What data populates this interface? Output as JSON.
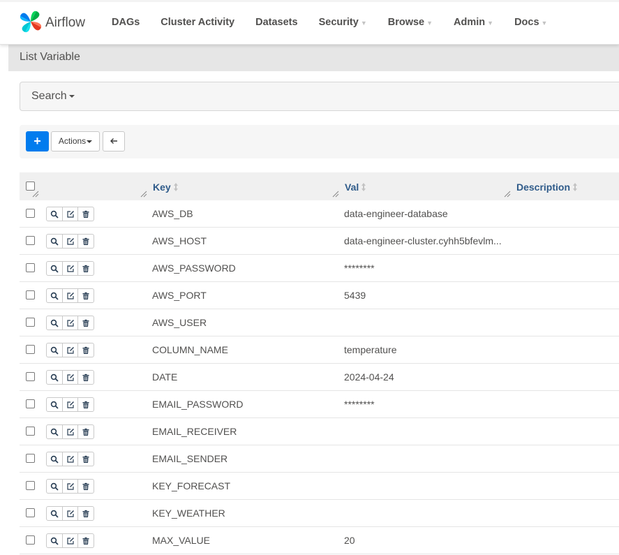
{
  "app": {
    "brand_name": "Airflow",
    "brand_colors": [
      "#017cee",
      "#00ad46",
      "#e43921",
      "#04d659",
      "#11e1ee",
      "#0cb6ff",
      "#ffd261",
      "#00c7d4"
    ]
  },
  "nav": {
    "items": [
      {
        "label": "DAGs",
        "dropdown": false
      },
      {
        "label": "Cluster Activity",
        "dropdown": false
      },
      {
        "label": "Datasets",
        "dropdown": false
      },
      {
        "label": "Security",
        "dropdown": true
      },
      {
        "label": "Browse",
        "dropdown": true
      },
      {
        "label": "Admin",
        "dropdown": true
      },
      {
        "label": "Docs",
        "dropdown": true
      }
    ]
  },
  "page": {
    "title": "List Variable",
    "search_label": "Search",
    "add_button_label": "+",
    "actions_label": "Actions",
    "back_icon": "arrow-left-icon"
  },
  "table": {
    "columns": [
      {
        "label": "Key",
        "sortable": true
      },
      {
        "label": "Val",
        "sortable": true
      },
      {
        "label": "Description",
        "sortable": true
      }
    ],
    "row_actions": [
      "search-icon",
      "edit-icon",
      "trash-icon"
    ],
    "rows": [
      {
        "key": "AWS_DB",
        "val": "data-engineer-database",
        "description": ""
      },
      {
        "key": "AWS_HOST",
        "val": "data-engineer-cluster.cyhh5bfevlm...",
        "description": ""
      },
      {
        "key": "AWS_PASSWORD",
        "val": "********",
        "description": ""
      },
      {
        "key": "AWS_PORT",
        "val": "5439",
        "description": ""
      },
      {
        "key": "AWS_USER",
        "val": "",
        "description": ""
      },
      {
        "key": "COLUMN_NAME",
        "val": "temperature",
        "description": ""
      },
      {
        "key": "DATE",
        "val": "2024-04-24",
        "description": ""
      },
      {
        "key": "EMAIL_PASSWORD",
        "val": "********",
        "description": ""
      },
      {
        "key": "EMAIL_RECEIVER",
        "val": "",
        "description": ""
      },
      {
        "key": "EMAIL_SENDER",
        "val": "",
        "description": ""
      },
      {
        "key": "KEY_FORECAST",
        "val": "",
        "description": ""
      },
      {
        "key": "KEY_WEATHER",
        "val": "",
        "description": ""
      },
      {
        "key": "MAX_VALUE",
        "val": "20",
        "description": ""
      }
    ]
  },
  "colors": {
    "primary": "#017cee",
    "header_link": "#2f5b8a",
    "text": "#51504f"
  }
}
